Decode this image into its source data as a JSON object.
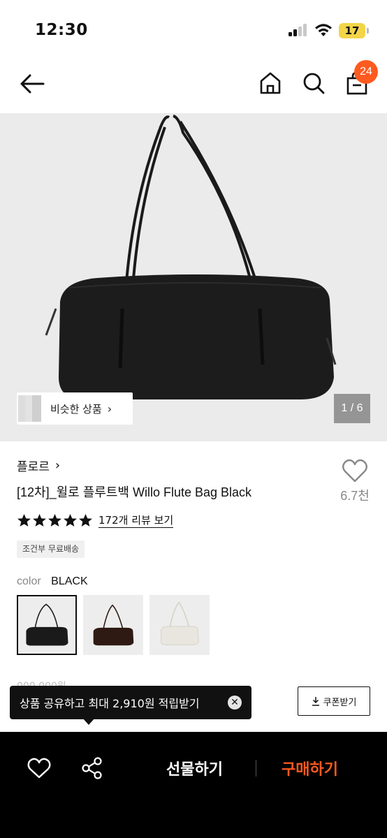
{
  "status_bar": {
    "time": "12:30",
    "battery": "17"
  },
  "header": {
    "cart_count": "24",
    "icons": [
      "back-arrow-icon",
      "home-icon",
      "search-icon",
      "shopping-bag-icon"
    ]
  },
  "gallery": {
    "similar_label": "비슷한 상품",
    "page_indicator": "1 / 6"
  },
  "product": {
    "brand": "플로르",
    "title": "[12차]_윌로 플루트백 Willo Flute Bag Black",
    "wish_count": "6.7천",
    "rating_stars": 5,
    "review_link": "172개 리뷰 보기",
    "shipping_badge": "조건부 무료배송",
    "color_label": "color",
    "color_value": "BLACK",
    "swatches": [
      {
        "name": "black",
        "color": "#1a1a1a"
      },
      {
        "name": "brown",
        "color": "#2e1a12"
      },
      {
        "name": "white",
        "color": "#e8e6df"
      }
    ],
    "price_partial": "000,000원"
  },
  "tooltip": {
    "text": "상품 공유하고 최대 2,910원 적립받기",
    "close": "✕"
  },
  "coupon": {
    "label": "쿠폰받기",
    "icon": "download-icon"
  },
  "action_bar": {
    "gift_label": "선물하기",
    "buy_label": "구매하기",
    "buy_color": "#ff5a1f"
  }
}
